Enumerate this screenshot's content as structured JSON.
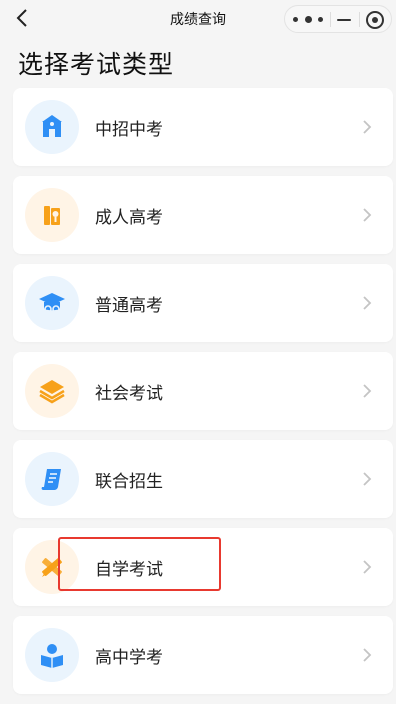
{
  "navbar": {
    "title": "成绩查询",
    "back_icon": "chevron-left-icon",
    "menu_icons": [
      "more-dots-icon",
      "minimize-icon",
      "close-circle-icon"
    ]
  },
  "page_heading": "选择考试类型",
  "exam_types": [
    {
      "label": "中招中考",
      "icon": "school-building-icon",
      "icon_bg": "blue"
    },
    {
      "label": "成人高考",
      "icon": "books-certificate-icon",
      "icon_bg": "orange"
    },
    {
      "label": "普通高考",
      "icon": "graduation-cap-icon",
      "icon_bg": "blue"
    },
    {
      "label": "社会考试",
      "icon": "layers-stack-icon",
      "icon_bg": "orange"
    },
    {
      "label": "联合招生",
      "icon": "document-scroll-icon",
      "icon_bg": "blue"
    },
    {
      "label": "自学考试",
      "icon": "pencil-ruler-icon",
      "icon_bg": "orange"
    },
    {
      "label": "高中学考",
      "icon": "reading-person-icon",
      "icon_bg": "blue"
    }
  ],
  "colors": {
    "blue_icon": "#2f8ff5",
    "orange_icon": "#f7a11a",
    "highlight_border": "#e8392f",
    "page_background": "#f5f5f5"
  },
  "highlighted_item": "自学考试"
}
